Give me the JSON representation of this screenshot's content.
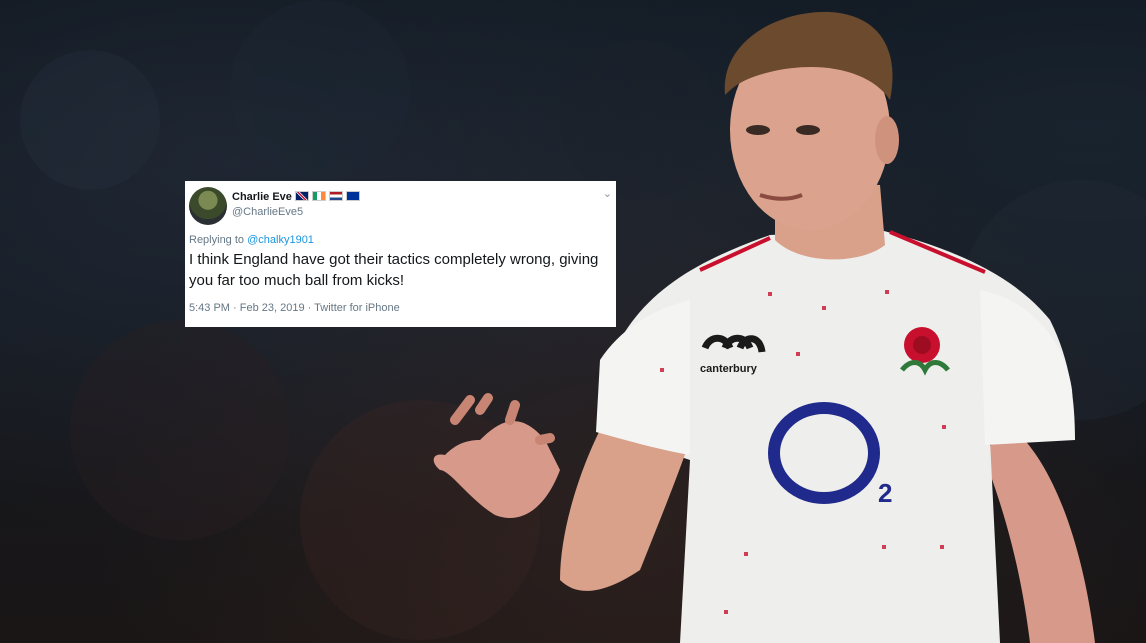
{
  "tweet": {
    "author_name": "Charlie Eve",
    "handle": "@CharlieEve5",
    "replying_prefix": "Replying to",
    "replying_to": "@chalky1901",
    "text": "I think England have got their tactics completely wrong, giving you far too much ball from kicks!",
    "meta": "5:43 PM · Feb 23, 2019 · Twitter for iPhone",
    "flags": [
      "uk-flag-icon",
      "ireland-flag-icon",
      "netherlands-flag-icon",
      "eu-flag-icon"
    ]
  },
  "photo": {
    "subject": "rugby-player-photo",
    "jersey_brand": "canterbury",
    "sponsor_logo": "O2",
    "colors": {
      "jersey": "#f2f2f0",
      "sponsor_blue": "#1f2a8c",
      "rose_red": "#c8102e",
      "collar_red": "#c8102e",
      "skin": "#d9a08a",
      "hair": "#6b4a2e"
    }
  }
}
